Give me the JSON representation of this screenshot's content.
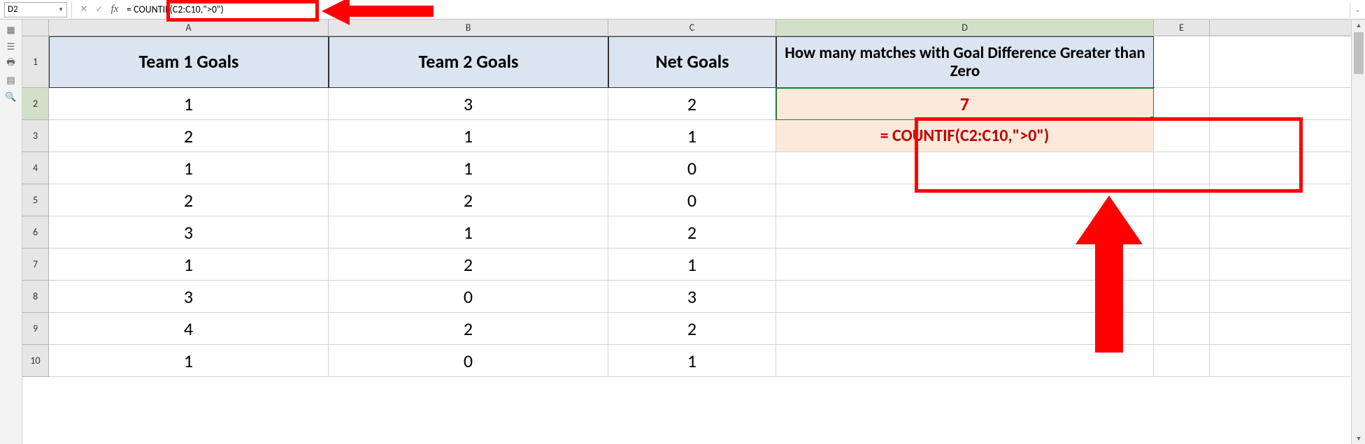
{
  "formula_bar": {
    "name_box_value": "D2",
    "cancel_icon": "✕",
    "enter_icon": "✓",
    "fx_label": "fx",
    "formula_text": "= COUNTIF(C2:C10,\">0\")"
  },
  "columns": {
    "A": "A",
    "B": "B",
    "C": "C",
    "D": "D",
    "E": "E"
  },
  "row_numbers": [
    "1",
    "2",
    "3",
    "4",
    "5",
    "6",
    "7",
    "8",
    "9",
    "10"
  ],
  "headers": {
    "A": "Team 1 Goals",
    "B": "Team 2 Goals",
    "C": "Net Goals",
    "D": "How many matches with Goal Difference Greater than Zero"
  },
  "table": [
    {
      "A": "1",
      "B": "3",
      "C": "2"
    },
    {
      "A": "2",
      "B": "1",
      "C": "1"
    },
    {
      "A": "1",
      "B": "1",
      "C": "0"
    },
    {
      "A": "2",
      "B": "2",
      "C": "0"
    },
    {
      "A": "3",
      "B": "1",
      "C": "2"
    },
    {
      "A": "1",
      "B": "2",
      "C": "1"
    },
    {
      "A": "3",
      "B": "0",
      "C": "3"
    },
    {
      "A": "4",
      "B": "2",
      "C": "2"
    },
    {
      "A": "1",
      "B": "0",
      "C": "1"
    }
  ],
  "result_cell_D2": "7",
  "formula_display_D3": "= COUNTIF(C2:C10,\">0\")"
}
